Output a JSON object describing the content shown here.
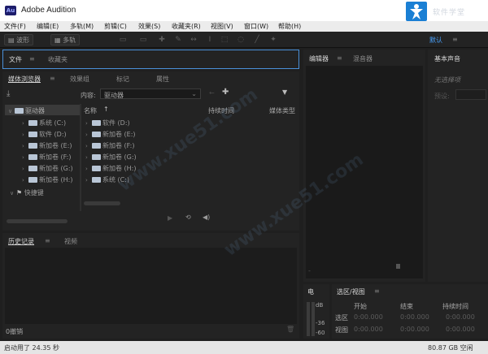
{
  "title_bar": {
    "app_icon_text": "Au",
    "title": "Adobe Audition",
    "watermark_text": "软件学堂"
  },
  "menu": [
    "文件(F)",
    "编辑(E)",
    "多轨(M)",
    "剪辑(C)",
    "效果(S)",
    "收藏夹(R)",
    "视图(V)",
    "窗口(W)",
    "帮助(H)"
  ],
  "toolbar": {
    "waveform_label": "波形",
    "multitrack_label": "多轨",
    "workspace_label": "默认",
    "workspace_menu": "≡"
  },
  "files_panel": {
    "tabs": [
      "文件",
      "收藏夹"
    ],
    "menu_icon": "≡"
  },
  "media_browser": {
    "tabs": [
      "媒体浏览器",
      "效果组",
      "标记",
      "属性"
    ],
    "content_label": "内容:",
    "content_value": "驱动器",
    "tree_root": "驱动器",
    "tree_drives": [
      "系统 (C:)",
      "软件 (D:)",
      "新加卷 (E:)",
      "新加卷 (F:)",
      "新加卷 (G:)",
      "新加卷 (H:)"
    ],
    "shortcuts": "快捷键",
    "columns": [
      "名称",
      "持续时间",
      "媒体类型"
    ],
    "list_items": [
      "软件 (D:)",
      "新加卷 (E:)",
      "新加卷 (F:)",
      "新加卷 (G:)",
      "新加卷 (H:)",
      "系统 (C:)"
    ]
  },
  "history_panel": {
    "tabs": [
      "历史记录",
      "视频"
    ],
    "undo_count": "0撤销"
  },
  "editor_panel": {
    "tabs": [
      "编辑器",
      "混音器"
    ]
  },
  "essential_sound": {
    "tab": "基本声音",
    "no_selection": "无选择项",
    "preset_label": "预设:"
  },
  "level_panel": {
    "tab": "电",
    "db_labels": [
      "dB",
      "-36",
      "-60"
    ]
  },
  "selection_panel": {
    "tab": "选区/视图",
    "headers": [
      "开始",
      "结束",
      "持续时间"
    ],
    "rows": [
      {
        "label": "选区",
        "start": "0:00.000",
        "end": "0:00.000",
        "duration": "0:00.000"
      },
      {
        "label": "视图",
        "start": "0:00.000",
        "end": "0:00.000",
        "duration": "0:00.000"
      }
    ]
  },
  "status_bar": {
    "left": "启动用了 24.35 秒",
    "right": "80.87 GB 空闲"
  }
}
